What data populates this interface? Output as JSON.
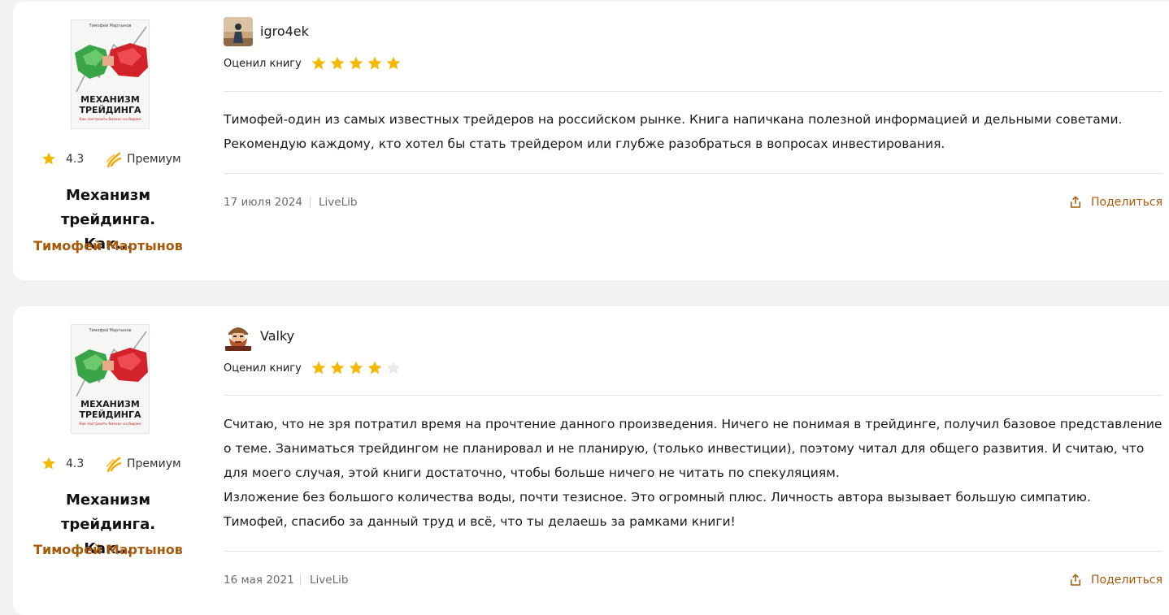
{
  "colors": {
    "accent": "#a85a0b",
    "star": "#f5b800",
    "star_empty": "#e9e9e9",
    "page_bg": "#f2f2f2",
    "card_bg": "#ffffff"
  },
  "reviews": [
    {
      "book": {
        "cover_author": "Тимофей Мартынов",
        "cover_title": "МЕХАНИЗМ ТРЕЙДИНГА",
        "cover_subtitle": "Как построить бизнес на бирже",
        "rating": "4.3",
        "badge": "Премиум",
        "title": "Механизм трейдинга. Как...",
        "author": "Тимофей Мартынов"
      },
      "user": {
        "name": "igro4ek",
        "avatar_icon": "user-photo-avatar"
      },
      "rated_label": "Оценил книгу",
      "stars": 5,
      "text": [
        "Тимофей-один из самых известных трейдеров на российском рынке. Книга напичкана полезной информацией и дельными советами. Рекомендую каждому, кто хотел бы стать трейдером или глубже разобраться в вопросах инвестирования."
      ],
      "date": "17 июля 2024",
      "source": "LiveLib",
      "share_label": "Поделиться"
    },
    {
      "book": {
        "cover_author": "Тимофей Мартынов",
        "cover_title": "МЕХАНИЗМ ТРЕЙДИНГА",
        "cover_subtitle": "Как построить бизнес на бирже",
        "rating": "4.3",
        "badge": "Премиум",
        "title": "Механизм трейдинга. Как...",
        "author": "Тимофей Мартынов"
      },
      "user": {
        "name": "Valky",
        "avatar_icon": "bearded-viking-avatar"
      },
      "rated_label": "Оценил книгу",
      "stars": 4,
      "text": [
        "Считаю, что не зря потратил время на прочтение данного произведения. Ничего не понимая в трейдинге, получил базовое представление о теме. Заниматься трейдингом не планировал и не планирую, (только инвестиции), поэтому читал для общего развития. И считаю, что для моего случая, этой книги достаточно, чтобы больше ничего не читать по спекуляциям.",
        "Изложение без большого количества воды, почти тезисное. Это огромный плюс. Личность автора вызывает большую симпатию.",
        "Тимофей, спасибо за данный труд и всё, что ты делаешь за рамками книги!"
      ],
      "date": "16 мая 2021",
      "source": "LiveLib",
      "share_label": "Поделиться"
    }
  ]
}
